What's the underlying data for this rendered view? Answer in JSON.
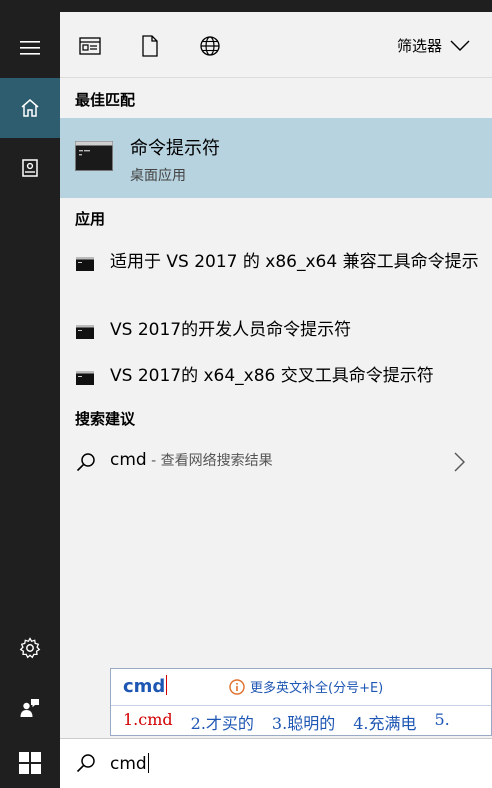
{
  "toolbar": {
    "filter_label": "筛选器"
  },
  "sections": {
    "best_match": "最佳匹配",
    "apps": "应用",
    "suggestions": "搜索建议"
  },
  "best_match": {
    "title": "命令提示符",
    "subtitle": "桌面应用"
  },
  "apps": [
    {
      "label": "适用于 VS 2017 的 x86_x64 兼容工具命令提示"
    },
    {
      "label": "VS 2017的开发人员命令提示符"
    },
    {
      "label": "VS 2017的 x64_x86 交叉工具命令提示符"
    }
  ],
  "suggestion": {
    "query": "cmd",
    "hint": " - 查看网络搜索结果"
  },
  "ime": {
    "composition": "cmd",
    "tip": "更多英文补全(分号+E)",
    "candidates": [
      "1.cmd",
      "2.才买的",
      "3.聪明的",
      "4.充满电",
      "5."
    ]
  },
  "search": {
    "value": "cmd"
  },
  "colors": {
    "accent": "#2d5d6e",
    "selection": "#b7d3e0",
    "ime_blue": "#1e56b3",
    "ime_red": "#d40000"
  }
}
